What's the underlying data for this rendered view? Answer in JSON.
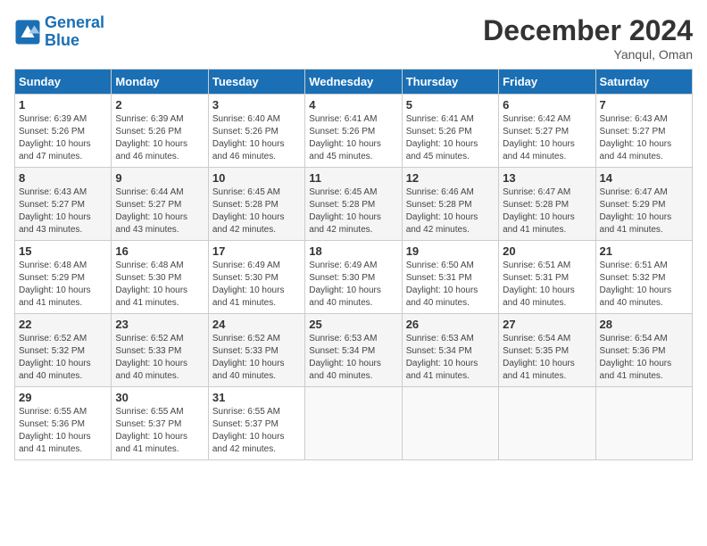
{
  "header": {
    "logo_line1": "General",
    "logo_line2": "Blue",
    "month_title": "December 2024",
    "location": "Yanqul, Oman"
  },
  "weekdays": [
    "Sunday",
    "Monday",
    "Tuesday",
    "Wednesday",
    "Thursday",
    "Friday",
    "Saturday"
  ],
  "weeks": [
    [
      {
        "day": "1",
        "sunrise": "6:39 AM",
        "sunset": "5:26 PM",
        "daylight": "10 hours and 47 minutes."
      },
      {
        "day": "2",
        "sunrise": "6:39 AM",
        "sunset": "5:26 PM",
        "daylight": "10 hours and 46 minutes."
      },
      {
        "day": "3",
        "sunrise": "6:40 AM",
        "sunset": "5:26 PM",
        "daylight": "10 hours and 46 minutes."
      },
      {
        "day": "4",
        "sunrise": "6:41 AM",
        "sunset": "5:26 PM",
        "daylight": "10 hours and 45 minutes."
      },
      {
        "day": "5",
        "sunrise": "6:41 AM",
        "sunset": "5:26 PM",
        "daylight": "10 hours and 45 minutes."
      },
      {
        "day": "6",
        "sunrise": "6:42 AM",
        "sunset": "5:27 PM",
        "daylight": "10 hours and 44 minutes."
      },
      {
        "day": "7",
        "sunrise": "6:43 AM",
        "sunset": "5:27 PM",
        "daylight": "10 hours and 44 minutes."
      }
    ],
    [
      {
        "day": "8",
        "sunrise": "6:43 AM",
        "sunset": "5:27 PM",
        "daylight": "10 hours and 43 minutes."
      },
      {
        "day": "9",
        "sunrise": "6:44 AM",
        "sunset": "5:27 PM",
        "daylight": "10 hours and 43 minutes."
      },
      {
        "day": "10",
        "sunrise": "6:45 AM",
        "sunset": "5:28 PM",
        "daylight": "10 hours and 42 minutes."
      },
      {
        "day": "11",
        "sunrise": "6:45 AM",
        "sunset": "5:28 PM",
        "daylight": "10 hours and 42 minutes."
      },
      {
        "day": "12",
        "sunrise": "6:46 AM",
        "sunset": "5:28 PM",
        "daylight": "10 hours and 42 minutes."
      },
      {
        "day": "13",
        "sunrise": "6:47 AM",
        "sunset": "5:28 PM",
        "daylight": "10 hours and 41 minutes."
      },
      {
        "day": "14",
        "sunrise": "6:47 AM",
        "sunset": "5:29 PM",
        "daylight": "10 hours and 41 minutes."
      }
    ],
    [
      {
        "day": "15",
        "sunrise": "6:48 AM",
        "sunset": "5:29 PM",
        "daylight": "10 hours and 41 minutes."
      },
      {
        "day": "16",
        "sunrise": "6:48 AM",
        "sunset": "5:30 PM",
        "daylight": "10 hours and 41 minutes."
      },
      {
        "day": "17",
        "sunrise": "6:49 AM",
        "sunset": "5:30 PM",
        "daylight": "10 hours and 41 minutes."
      },
      {
        "day": "18",
        "sunrise": "6:49 AM",
        "sunset": "5:30 PM",
        "daylight": "10 hours and 40 minutes."
      },
      {
        "day": "19",
        "sunrise": "6:50 AM",
        "sunset": "5:31 PM",
        "daylight": "10 hours and 40 minutes."
      },
      {
        "day": "20",
        "sunrise": "6:51 AM",
        "sunset": "5:31 PM",
        "daylight": "10 hours and 40 minutes."
      },
      {
        "day": "21",
        "sunrise": "6:51 AM",
        "sunset": "5:32 PM",
        "daylight": "10 hours and 40 minutes."
      }
    ],
    [
      {
        "day": "22",
        "sunrise": "6:52 AM",
        "sunset": "5:32 PM",
        "daylight": "10 hours and 40 minutes."
      },
      {
        "day": "23",
        "sunrise": "6:52 AM",
        "sunset": "5:33 PM",
        "daylight": "10 hours and 40 minutes."
      },
      {
        "day": "24",
        "sunrise": "6:52 AM",
        "sunset": "5:33 PM",
        "daylight": "10 hours and 40 minutes."
      },
      {
        "day": "25",
        "sunrise": "6:53 AM",
        "sunset": "5:34 PM",
        "daylight": "10 hours and 40 minutes."
      },
      {
        "day": "26",
        "sunrise": "6:53 AM",
        "sunset": "5:34 PM",
        "daylight": "10 hours and 41 minutes."
      },
      {
        "day": "27",
        "sunrise": "6:54 AM",
        "sunset": "5:35 PM",
        "daylight": "10 hours and 41 minutes."
      },
      {
        "day": "28",
        "sunrise": "6:54 AM",
        "sunset": "5:36 PM",
        "daylight": "10 hours and 41 minutes."
      }
    ],
    [
      {
        "day": "29",
        "sunrise": "6:55 AM",
        "sunset": "5:36 PM",
        "daylight": "10 hours and 41 minutes."
      },
      {
        "day": "30",
        "sunrise": "6:55 AM",
        "sunset": "5:37 PM",
        "daylight": "10 hours and 41 minutes."
      },
      {
        "day": "31",
        "sunrise": "6:55 AM",
        "sunset": "5:37 PM",
        "daylight": "10 hours and 42 minutes."
      },
      null,
      null,
      null,
      null
    ]
  ]
}
